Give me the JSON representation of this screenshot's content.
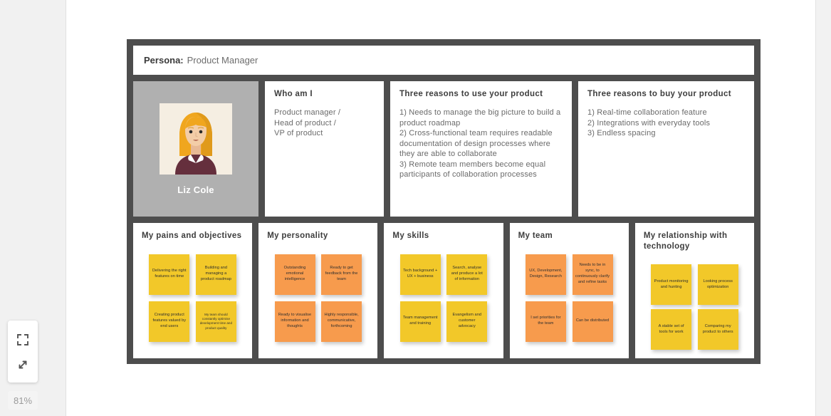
{
  "zoom_control": {
    "fit_icon": "fit-to-screen-icon",
    "expand_icon": "expand-diagonal-icon",
    "level": "81%"
  },
  "board": {
    "header": {
      "label": "Persona:",
      "value": "Product Manager"
    },
    "avatar": {
      "name": "Liz Cole",
      "icon": "persona-avatar-illustration"
    },
    "top_panels": [
      {
        "id": "who-am-i",
        "title": "Who am I",
        "body": "Product manager /\nHead of product /\nVP of product"
      },
      {
        "id": "reasons-to-use",
        "title": "Three reasons to use your product",
        "body": "1) Needs to manage the big picture to build a product roadmap\n2) Cross-functional team requires readable documentation of design processes where they are able to collaborate\n3) Remote team members become equal participants of collaboration processes"
      },
      {
        "id": "reasons-to-buy",
        "title": "Three reasons to buy your product",
        "body": "1) Real-time collaboration feature\n2) Integrations with everyday tools\n3) Endless spacing"
      }
    ],
    "note_panels": [
      {
        "id": "pains-and-objectives",
        "title": "My pains and objectives",
        "color": "yellow",
        "notes": [
          "Delivering the right features on time",
          "Building and managing a product roadmap",
          "Creating product features valued by end users",
          "My team should constantly optimise development time and product quality"
        ]
      },
      {
        "id": "my-personality",
        "title": "My personality",
        "color": "orange",
        "notes": [
          "Outstanding emotional intelligence",
          "Ready to get feedback from the team",
          "Ready to visualise information and thoughts",
          "Highly responsible, communicative, forthcoming"
        ]
      },
      {
        "id": "my-skills",
        "title": "My skills",
        "color": "yellow",
        "notes": [
          "Tech background + UX + business",
          "Search, analyse and produce a lot of information",
          "Team management and training",
          "Evangelism and customer advocacy"
        ]
      },
      {
        "id": "my-team",
        "title": "My team",
        "color": "orange",
        "notes": [
          "UX, Development, Design, Research",
          "Needs to be in sync, to continuously clarify and refine tasks",
          "I set priorities for the team",
          "Can be distributed"
        ]
      },
      {
        "id": "relationship-with-technology",
        "title": "My relationship with technology",
        "color": "yellow",
        "notes": [
          "Product monitoring and hunting",
          "Looking process optimization",
          "A stable set of tools for work",
          "Comparing my product to others"
        ]
      }
    ]
  },
  "colors": {
    "board_frame": "#4d4d4d",
    "note_yellow": "#f2c829",
    "note_orange": "#f79b4d",
    "avatar_backdrop": "#b0b0b0"
  }
}
